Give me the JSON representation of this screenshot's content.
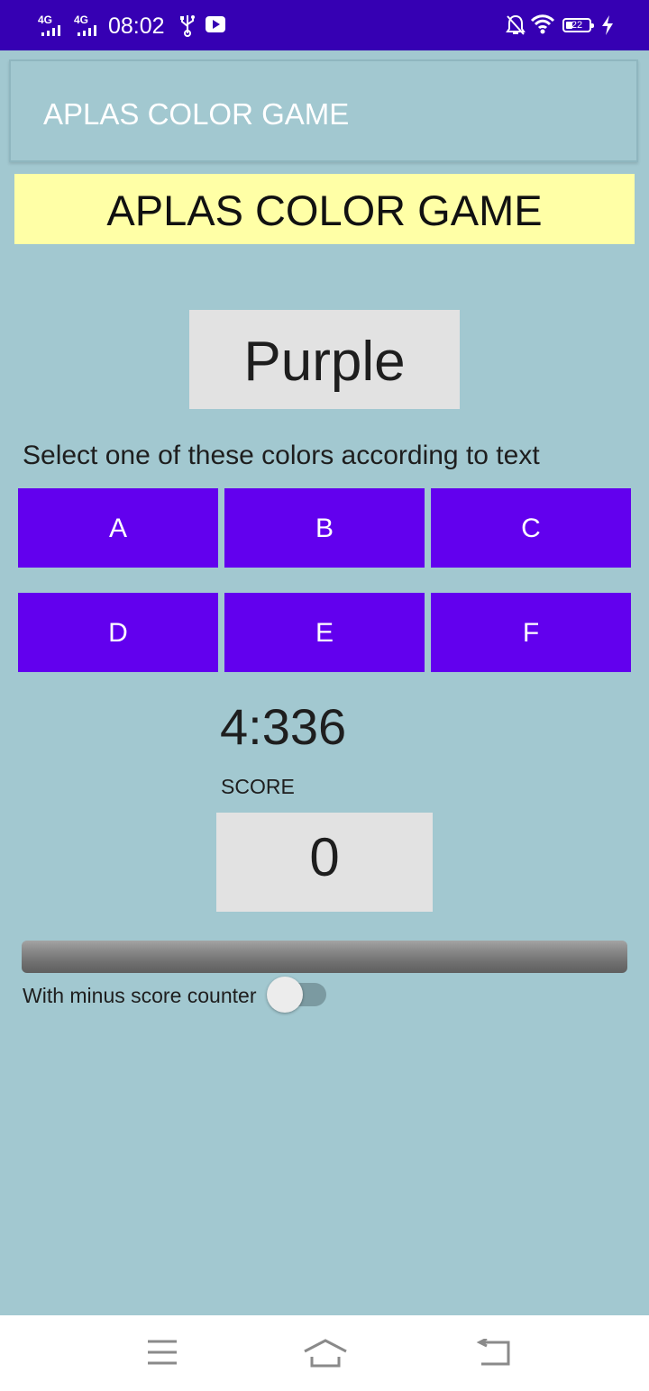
{
  "status_bar": {
    "network_1": "4G",
    "network_2": "4G",
    "time": "08:02",
    "battery": "22",
    "icons": [
      "signal-icon",
      "signal-icon",
      "usb-icon",
      "youtube-icon",
      "mute-icon",
      "wifi-icon",
      "battery-icon",
      "charging-icon"
    ]
  },
  "app_bar": {
    "title": "APLAS COLOR GAME"
  },
  "banner": {
    "text": "APLAS COLOR GAME"
  },
  "game": {
    "color_word": "Purple",
    "instruction": "Select one of these colors according to text",
    "buttons": [
      "A",
      "B",
      "C",
      "D",
      "E",
      "F"
    ],
    "button_color": "#6200EE",
    "timer": "4:336",
    "score_label": "SCORE",
    "score": "0",
    "switch_label": "With minus score counter",
    "switch_on": false
  },
  "nav_bar": {
    "icons": [
      "menu-icon",
      "home-icon",
      "back-icon"
    ]
  },
  "colors": {
    "status_bar": "#3600B3",
    "background": "#A2C8D0",
    "banner": "#FFFFA6"
  }
}
